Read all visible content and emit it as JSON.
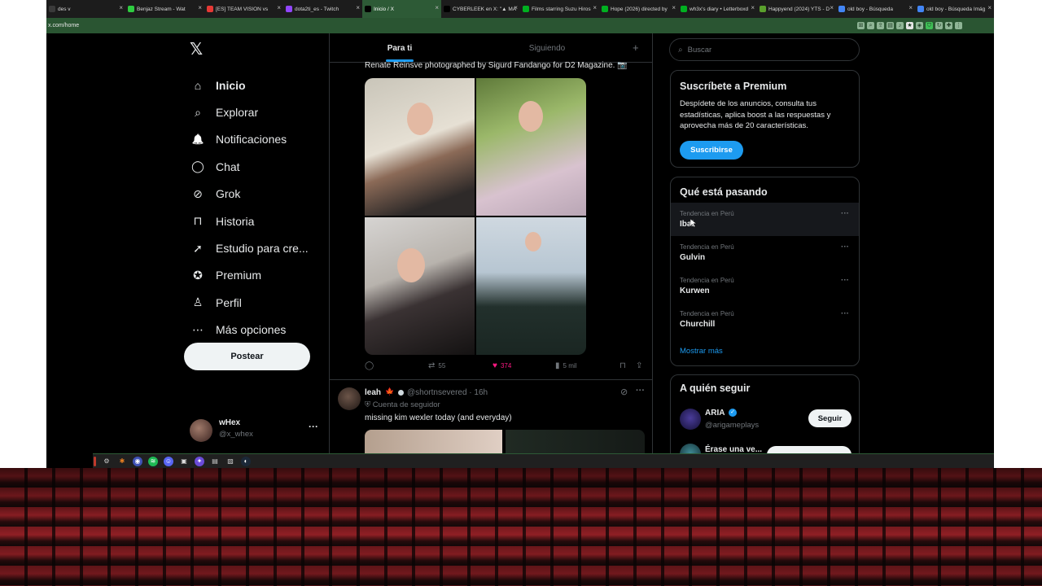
{
  "browser": {
    "tabs": [
      {
        "label": "des v",
        "fav": "#3a3a3a"
      },
      {
        "label": "Benjaz Stream - Wat",
        "fav": "#2ecc40"
      },
      {
        "label": "[ES] TEAM VISION vs",
        "fav": "#e53935"
      },
      {
        "label": "dota2ti_es - Twitch",
        "fav": "#9146ff"
      },
      {
        "label": "Inicio / X",
        "fav": "#000000",
        "active": true
      },
      {
        "label": "CYBERLEEK en X: \"▲ MA",
        "fav": "#000000"
      },
      {
        "label": "Films starring Suzu Hiros",
        "fav": "#00b020"
      },
      {
        "label": "Hope (2026) directed by",
        "fav": "#00b020"
      },
      {
        "label": "wh3x's diary • Letterboxd",
        "fav": "#00b020"
      },
      {
        "label": "Happyend (2024) YTS - D",
        "fav": "#5aa02c"
      },
      {
        "label": "old boy - Búsqueda",
        "fav": "#4285f4"
      },
      {
        "label": "old boy - Búsqueda Imág",
        "fav": "#4285f4"
      }
    ],
    "url": "x.com/home"
  },
  "nav": {
    "items": [
      {
        "label": "Inicio",
        "icon": "home-icon"
      },
      {
        "label": "Explorar",
        "icon": "search-icon"
      },
      {
        "label": "Notificaciones",
        "icon": "bell-icon"
      },
      {
        "label": "Chat",
        "icon": "chat-icon"
      },
      {
        "label": "Grok",
        "icon": "grok-icon"
      },
      {
        "label": "Historia",
        "icon": "bookmark-icon"
      },
      {
        "label": "Estudio para cre...",
        "icon": "rocket-icon"
      },
      {
        "label": "Premium",
        "icon": "premium-icon"
      },
      {
        "label": "Perfil",
        "icon": "profile-icon"
      },
      {
        "label": "Más opciones",
        "icon": "more-options-icon"
      }
    ],
    "post_label": "Postear",
    "account": {
      "name": "wHex",
      "handle": "@x_whex"
    }
  },
  "feed": {
    "tabs": {
      "for_you": "Para ti",
      "following": "Siguiendo"
    },
    "tweet1": {
      "caption": "Renate Reinsve photographed by Sigurd Fandango for D2 Magazine. 📷",
      "retweets": "55",
      "likes": "374",
      "views": "5 mil"
    },
    "tweet2": {
      "name": "leah",
      "handle": "@shortnsevered · 16h",
      "follower_label": "Cuenta de seguidor",
      "text": "missing kim wexler today (and everyday)"
    }
  },
  "sidebar": {
    "search_placeholder": "Buscar",
    "premium": {
      "title": "Suscríbete a Premium",
      "description": "Despídete de los anuncios, consulta tus estadísticas, aplica boost a las respuestas y aprovecha más de 20 características.",
      "button": "Suscribirse"
    },
    "trends": {
      "title": "Qué está pasando",
      "items": [
        {
          "context": "Tendencia en Perú",
          "name": "Ibai"
        },
        {
          "context": "Tendencia en Perú",
          "name": "Gulvin"
        },
        {
          "context": "Tendencia en Perú",
          "name": "Kurwen"
        },
        {
          "context": "Tendencia en Perú",
          "name": "Churchill"
        }
      ],
      "show_more": "Mostrar más"
    },
    "who_to_follow": {
      "title": "A quién seguir",
      "user": {
        "name": "ARIA",
        "handle": "@arigameplays",
        "button": "Seguir"
      },
      "user2": {
        "name": "Érase una ve..."
      }
    }
  },
  "colors": {
    "accent": "#1d9bf0",
    "like": "#f91880",
    "browser_green": "#2d5a36"
  }
}
